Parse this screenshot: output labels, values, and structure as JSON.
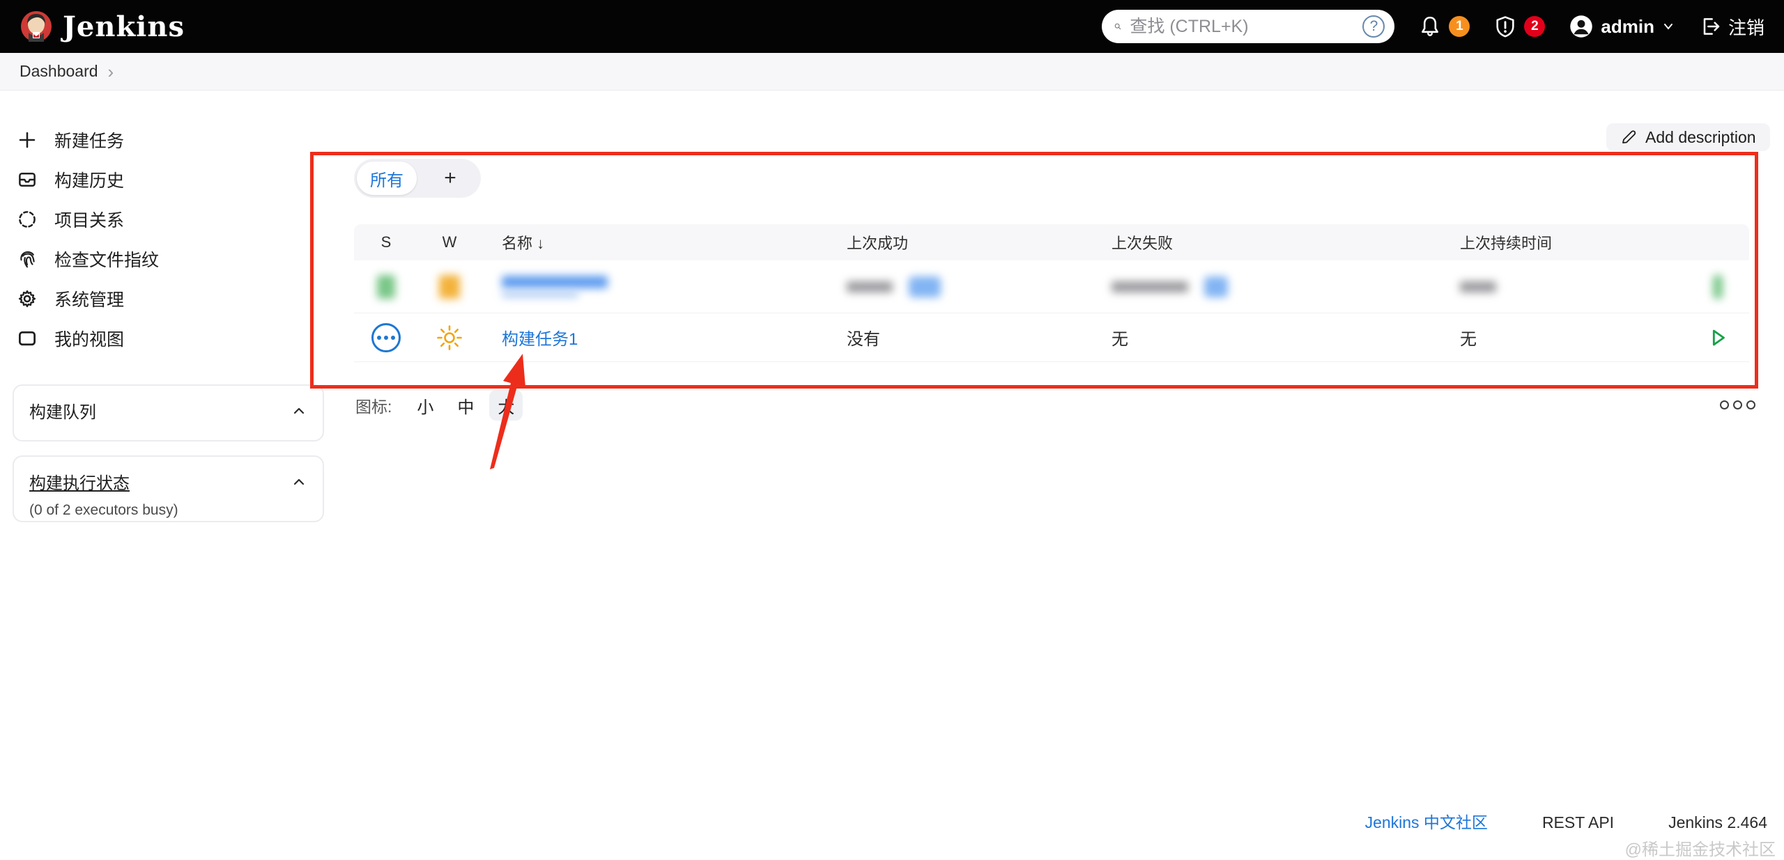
{
  "topbar": {
    "logo_text": "Jenkins",
    "search_placeholder": "查找 (CTRL+K)",
    "help_glyph": "?",
    "notification_badge": "1",
    "security_badge": "2",
    "username": "admin",
    "logout_label": "注销"
  },
  "breadcrumb": {
    "items": [
      {
        "label": "Dashboard"
      }
    ]
  },
  "sidebar": {
    "items": [
      {
        "label": "新建任务",
        "icon": "plus-icon"
      },
      {
        "label": "构建历史",
        "icon": "build-history-icon"
      },
      {
        "label": "项目关系",
        "icon": "project-relationship-icon"
      },
      {
        "label": "检查文件指纹",
        "icon": "fingerprint-icon"
      },
      {
        "label": "系统管理",
        "icon": "gear-icon"
      },
      {
        "label": "我的视图",
        "icon": "my-views-icon"
      }
    ],
    "build_queue": {
      "title": "构建队列"
    },
    "executor_status": {
      "title": "构建执行状态",
      "subtitle": "(0 of 2 executors busy)"
    }
  },
  "main": {
    "add_description_label": "Add description",
    "tabs": {
      "all_label": "所有",
      "new_view_label": "+"
    },
    "table": {
      "headers": [
        "S",
        "W",
        "名称",
        "上次成功",
        "上次失败",
        "上次持续时间"
      ],
      "name_sort_arrow": "↓",
      "rows": [
        {
          "type": "blurred"
        },
        {
          "name": "构建任务1",
          "last_success": "没有",
          "last_failure": "无",
          "last_duration": "无",
          "status_icon": "never-built",
          "weather_icon": "sunny",
          "action_icon": "run-build"
        }
      ]
    },
    "icon_size": {
      "label": "图标:",
      "options": [
        "小",
        "中",
        "大"
      ],
      "selected": "大"
    }
  },
  "footer": {
    "community_link": "Jenkins 中文社区",
    "rest_api_link": "REST API",
    "version": "Jenkins 2.464",
    "watermark": "@稀土掘金技术社区"
  },
  "colors": {
    "annotation_red": "#ed2d1b",
    "link_blue": "#1d76d9",
    "sun_orange": "#f3a40c",
    "run_green": "#18a24a",
    "notification_orange": "#f78f1e",
    "security_red": "#e2001a"
  }
}
